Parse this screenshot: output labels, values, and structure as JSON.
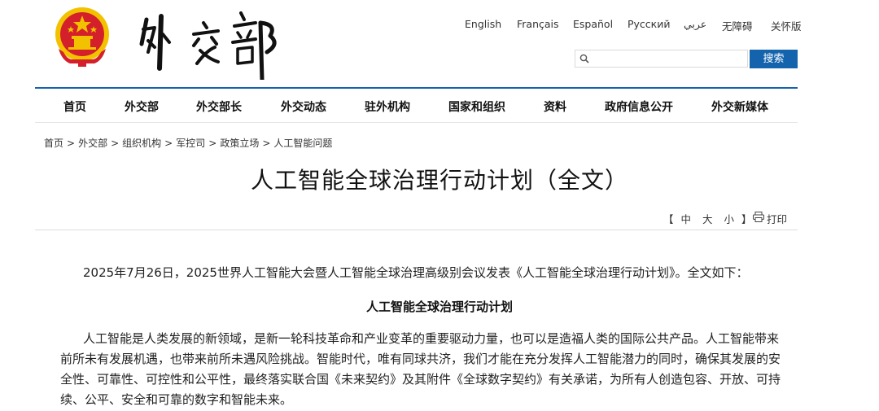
{
  "header": {
    "logo_text": "外交部",
    "languages": [
      "English",
      "Français",
      "Español",
      "Русский",
      "عربي",
      "无障碍",
      "关怀版"
    ],
    "search": {
      "placeholder": "",
      "button_label": "搜索"
    }
  },
  "nav": {
    "items": [
      "首页",
      "外交部",
      "外交部长",
      "外交动态",
      "驻外机构",
      "国家和组织",
      "资料",
      "政府信息公开",
      "外交新媒体"
    ]
  },
  "breadcrumb": {
    "items": [
      "首页",
      "外交部",
      "组织机构",
      "军控司",
      "政策立场",
      "人工智能问题"
    ],
    "separator": ">"
  },
  "article": {
    "title": "人工智能全球治理行动计划（全文）",
    "font_size": {
      "open": "【",
      "large": "中",
      "medium": "大",
      "small": "小",
      "close": "】"
    },
    "print_label": "打印",
    "intro": "2025年7月26日，2025世界人工智能大会暨人工智能全球治理高级别会议发表《人工智能全球治理行动计划》。全文如下：",
    "subtitle": "人工智能全球治理行动计划",
    "body": "人工智能是人类发展的新领域，是新一轮科技革命和产业变革的重要驱动力量，也可以是造福人类的国际公共产品。人工智能带来前所未有发展机遇，也带来前所未遇风险挑战。智能时代，唯有同球共济，我们才能在充分发挥人工智能潜力的同时，确保其发展的安全性、可靠性、可控性和公平性，最终落实联合国《未来契约》及其附件《全球数字契约》有关承诺，为所有人创造包容、开放、可持续、公平、安全和可靠的数字和智能未来。"
  },
  "colors": {
    "accent": "#1363ad",
    "emblem_red": "#d4202a",
    "emblem_gold": "#f2c200"
  }
}
